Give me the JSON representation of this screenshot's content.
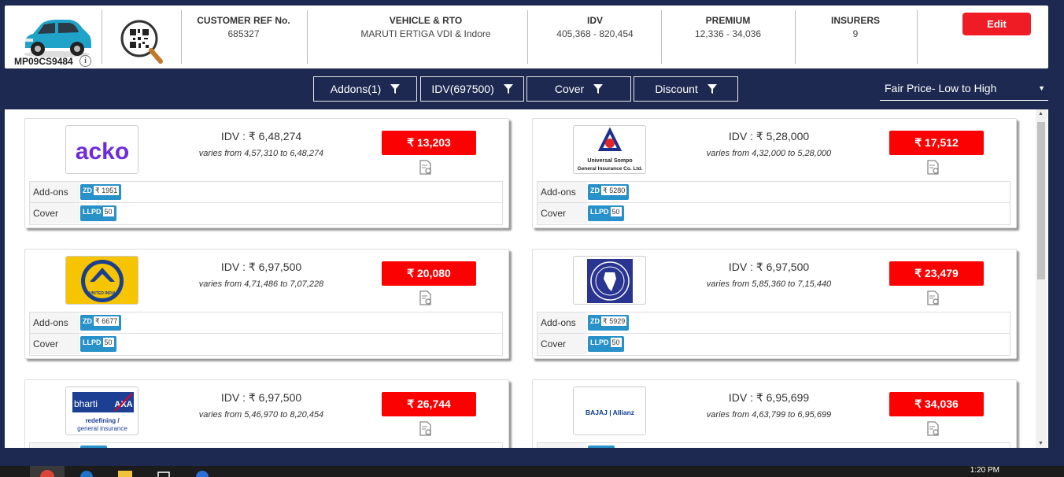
{
  "header": {
    "plate": "MP09CS9484",
    "info_glyph": "i",
    "columns": [
      {
        "title": "CUSTOMER REF No.",
        "value": "685327"
      },
      {
        "title": "VEHICLE & RTO",
        "value": "MARUTI ERTIGA VDI & Indore"
      },
      {
        "title": "IDV",
        "value": "405,368 - 820,454"
      },
      {
        "title": "PREMIUM",
        "value": "12,336 - 34,036"
      },
      {
        "title": "INSURERS",
        "value": "9"
      }
    ],
    "edit_label": "Edit"
  },
  "filters": [
    {
      "label": "Addons(1)"
    },
    {
      "label": "IDV(697500)"
    },
    {
      "label": "Cover"
    },
    {
      "label": "Discount"
    }
  ],
  "sort": {
    "label": "Fair Price- Low to High",
    "caret": "▼"
  },
  "cards": [
    {
      "insurer_logo": "acko",
      "idv": "IDV : ₹ 6,48,274",
      "varies": "varies from 4,57,310 to 6,48,274",
      "price": "₹ 13,203",
      "addons_label": "Add-ons",
      "addon_code": "ZD",
      "addon_value": "₹ 1951",
      "cover_label": "Cover",
      "cover_code": "LLPD",
      "cover_value": "50"
    },
    {
      "insurer_logo": "universal-sompo",
      "logo_text_1": "Universal Sompo",
      "logo_text_2": "General Insurance Co. Ltd.",
      "idv": "IDV : ₹ 5,28,000",
      "varies": "varies from 4,32,000 to 5,28,000",
      "price": "₹ 17,512",
      "addons_label": "Add-ons",
      "addon_code": "ZD",
      "addon_value": "₹ 5280",
      "cover_label": "Cover",
      "cover_code": "LLPD",
      "cover_value": "50"
    },
    {
      "insurer_logo": "united-india",
      "logo_text_1": "UNITED INDIA",
      "idv": "IDV : ₹ 6,97,500",
      "varies": "varies from 4,71,486 to 7,07,228",
      "price": "₹ 20,080",
      "addons_label": "Add-ons",
      "addon_code": "ZD",
      "addon_value": "₹ 6677",
      "cover_label": "Cover",
      "cover_code": "LLPD",
      "cover_value": "50"
    },
    {
      "insurer_logo": "new-india-assurance",
      "idv": "IDV : ₹ 6,97,500",
      "varies": "varies from 5,85,360 to 7,15,440",
      "price": "₹ 23,479",
      "addons_label": "Add-ons",
      "addon_code": "ZD",
      "addon_value": "₹ 5929",
      "cover_label": "Cover",
      "cover_code": "LLPD",
      "cover_value": "50"
    },
    {
      "insurer_logo": "bharti-axa",
      "logo_text_1": "bharti",
      "logo_text_2": "AXA",
      "logo_text_3": "redefining /",
      "logo_text_4": "general insurance",
      "idv": "IDV : ₹ 6,97,500",
      "varies": "varies from 5,46,970 to 8,20,454",
      "price": "₹ 26,744"
    },
    {
      "insurer_logo": "bajaj-allianz",
      "logo_text_1": "BAJAJ | Allianz",
      "idv": "IDV : ₹ 6,95,699",
      "varies": "varies from 4,63,799 to 6,95,699",
      "price": "₹ 34,036"
    }
  ],
  "taskbar": {
    "time": "1:20 PM"
  },
  "colors": {
    "navy": "#1d2951",
    "red": "#fb0102",
    "badge_blue": "#2891c9"
  }
}
